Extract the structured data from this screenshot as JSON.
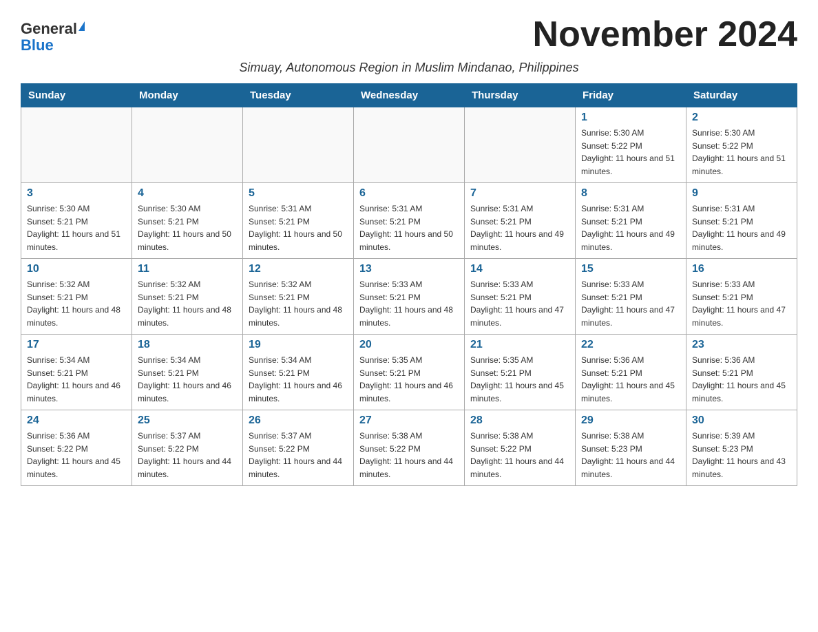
{
  "header": {
    "logo_general": "General",
    "logo_blue": "Blue",
    "month_title": "November 2024",
    "subtitle": "Simuay, Autonomous Region in Muslim Mindanao, Philippines"
  },
  "days_of_week": [
    "Sunday",
    "Monday",
    "Tuesday",
    "Wednesday",
    "Thursday",
    "Friday",
    "Saturday"
  ],
  "weeks": [
    [
      {
        "day": "",
        "info": ""
      },
      {
        "day": "",
        "info": ""
      },
      {
        "day": "",
        "info": ""
      },
      {
        "day": "",
        "info": ""
      },
      {
        "day": "",
        "info": ""
      },
      {
        "day": "1",
        "info": "Sunrise: 5:30 AM\nSunset: 5:22 PM\nDaylight: 11 hours and 51 minutes."
      },
      {
        "day": "2",
        "info": "Sunrise: 5:30 AM\nSunset: 5:22 PM\nDaylight: 11 hours and 51 minutes."
      }
    ],
    [
      {
        "day": "3",
        "info": "Sunrise: 5:30 AM\nSunset: 5:21 PM\nDaylight: 11 hours and 51 minutes."
      },
      {
        "day": "4",
        "info": "Sunrise: 5:30 AM\nSunset: 5:21 PM\nDaylight: 11 hours and 50 minutes."
      },
      {
        "day": "5",
        "info": "Sunrise: 5:31 AM\nSunset: 5:21 PM\nDaylight: 11 hours and 50 minutes."
      },
      {
        "day": "6",
        "info": "Sunrise: 5:31 AM\nSunset: 5:21 PM\nDaylight: 11 hours and 50 minutes."
      },
      {
        "day": "7",
        "info": "Sunrise: 5:31 AM\nSunset: 5:21 PM\nDaylight: 11 hours and 49 minutes."
      },
      {
        "day": "8",
        "info": "Sunrise: 5:31 AM\nSunset: 5:21 PM\nDaylight: 11 hours and 49 minutes."
      },
      {
        "day": "9",
        "info": "Sunrise: 5:31 AM\nSunset: 5:21 PM\nDaylight: 11 hours and 49 minutes."
      }
    ],
    [
      {
        "day": "10",
        "info": "Sunrise: 5:32 AM\nSunset: 5:21 PM\nDaylight: 11 hours and 48 minutes."
      },
      {
        "day": "11",
        "info": "Sunrise: 5:32 AM\nSunset: 5:21 PM\nDaylight: 11 hours and 48 minutes."
      },
      {
        "day": "12",
        "info": "Sunrise: 5:32 AM\nSunset: 5:21 PM\nDaylight: 11 hours and 48 minutes."
      },
      {
        "day": "13",
        "info": "Sunrise: 5:33 AM\nSunset: 5:21 PM\nDaylight: 11 hours and 48 minutes."
      },
      {
        "day": "14",
        "info": "Sunrise: 5:33 AM\nSunset: 5:21 PM\nDaylight: 11 hours and 47 minutes."
      },
      {
        "day": "15",
        "info": "Sunrise: 5:33 AM\nSunset: 5:21 PM\nDaylight: 11 hours and 47 minutes."
      },
      {
        "day": "16",
        "info": "Sunrise: 5:33 AM\nSunset: 5:21 PM\nDaylight: 11 hours and 47 minutes."
      }
    ],
    [
      {
        "day": "17",
        "info": "Sunrise: 5:34 AM\nSunset: 5:21 PM\nDaylight: 11 hours and 46 minutes."
      },
      {
        "day": "18",
        "info": "Sunrise: 5:34 AM\nSunset: 5:21 PM\nDaylight: 11 hours and 46 minutes."
      },
      {
        "day": "19",
        "info": "Sunrise: 5:34 AM\nSunset: 5:21 PM\nDaylight: 11 hours and 46 minutes."
      },
      {
        "day": "20",
        "info": "Sunrise: 5:35 AM\nSunset: 5:21 PM\nDaylight: 11 hours and 46 minutes."
      },
      {
        "day": "21",
        "info": "Sunrise: 5:35 AM\nSunset: 5:21 PM\nDaylight: 11 hours and 45 minutes."
      },
      {
        "day": "22",
        "info": "Sunrise: 5:36 AM\nSunset: 5:21 PM\nDaylight: 11 hours and 45 minutes."
      },
      {
        "day": "23",
        "info": "Sunrise: 5:36 AM\nSunset: 5:21 PM\nDaylight: 11 hours and 45 minutes."
      }
    ],
    [
      {
        "day": "24",
        "info": "Sunrise: 5:36 AM\nSunset: 5:22 PM\nDaylight: 11 hours and 45 minutes."
      },
      {
        "day": "25",
        "info": "Sunrise: 5:37 AM\nSunset: 5:22 PM\nDaylight: 11 hours and 44 minutes."
      },
      {
        "day": "26",
        "info": "Sunrise: 5:37 AM\nSunset: 5:22 PM\nDaylight: 11 hours and 44 minutes."
      },
      {
        "day": "27",
        "info": "Sunrise: 5:38 AM\nSunset: 5:22 PM\nDaylight: 11 hours and 44 minutes."
      },
      {
        "day": "28",
        "info": "Sunrise: 5:38 AM\nSunset: 5:22 PM\nDaylight: 11 hours and 44 minutes."
      },
      {
        "day": "29",
        "info": "Sunrise: 5:38 AM\nSunset: 5:23 PM\nDaylight: 11 hours and 44 minutes."
      },
      {
        "day": "30",
        "info": "Sunrise: 5:39 AM\nSunset: 5:23 PM\nDaylight: 11 hours and 43 minutes."
      }
    ]
  ]
}
